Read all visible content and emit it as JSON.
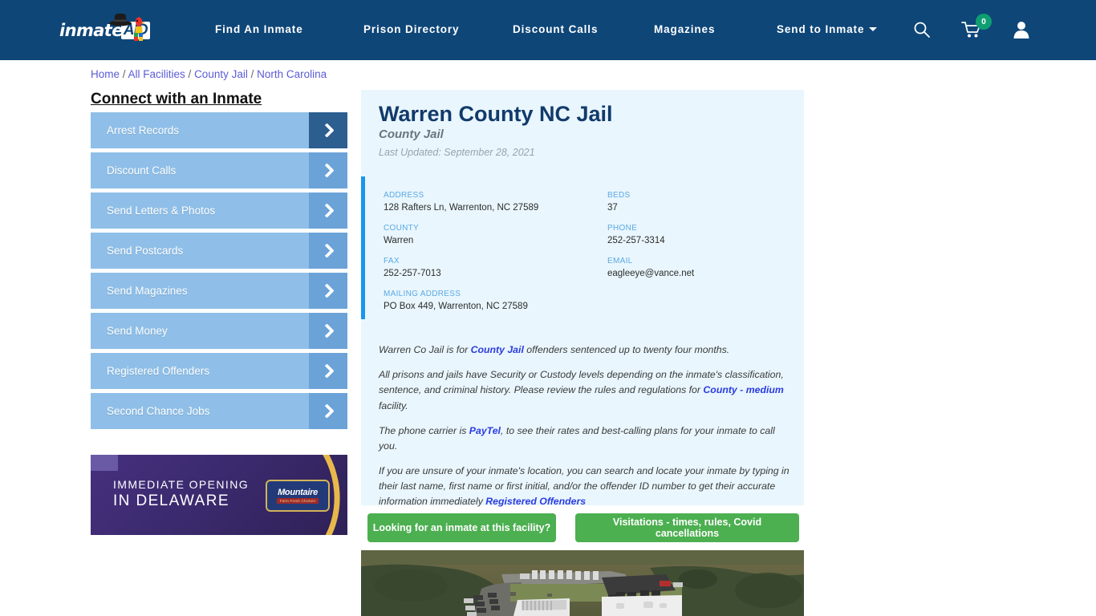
{
  "nav": {
    "logo_text": "inmate",
    "logo_badge": "AID",
    "items": [
      {
        "label": "Find An Inmate"
      },
      {
        "label": "Prison Directory"
      },
      {
        "label": "Discount Calls"
      },
      {
        "label": "Magazines"
      },
      {
        "label": "Send to Inmate"
      }
    ],
    "cart_count": "0",
    "search_icon": "search-icon",
    "cart_icon": "cart-icon",
    "user_icon": "user-icon",
    "bg_color": "#0e4678"
  },
  "breadcrumb": {
    "items": [
      "Home",
      "All Facilities",
      "County Jail",
      "North Carolina"
    ],
    "separator": "/"
  },
  "sidebar": {
    "title": "Connect with an Inmate",
    "items": [
      {
        "label": "Arrest Records"
      },
      {
        "label": "Discount Calls"
      },
      {
        "label": "Send Letters & Photos"
      },
      {
        "label": "Send Postcards"
      },
      {
        "label": "Send Magazines"
      },
      {
        "label": "Send Money"
      },
      {
        "label": "Registered Offenders"
      },
      {
        "label": "Second Chance Jobs"
      }
    ]
  },
  "ad": {
    "line1": "IMMEDIATE OPENING",
    "line2": "IN DELAWARE",
    "brand": "Mountaire",
    "brand_sub": "Farm Fresh Chicken",
    "bg_color": "#3b2a6e",
    "accent_color": "#e8b84b"
  },
  "facility": {
    "title": "Warren County NC Jail",
    "type": "County Jail",
    "updated": "Last Updated: September 28, 2021",
    "details": [
      {
        "key": "ADDRESS",
        "value": "128 Rafters Ln, Warrenton, NC 27589"
      },
      {
        "key": "BEDS",
        "value": "37"
      },
      {
        "key": "COUNTY",
        "value": "Warren"
      },
      {
        "key": "PHONE",
        "value": "252-257-3314"
      },
      {
        "key": "FAX",
        "value": "252-257-7013"
      },
      {
        "key": "EMAIL",
        "value": "eagleeye@vance.net"
      },
      {
        "key": "MAILING ADDRESS",
        "value": "PO Box 449, Warrenton, NC 27589"
      }
    ],
    "paragraphs": {
      "p1_a": "Warren Co Jail is for ",
      "p1_link": "County Jail",
      "p1_b": " offenders sentenced up to twenty four months.",
      "p2_a": "All prisons and jails have Security or Custody levels depending on the inmate's classification, sentence, and criminal history. Please review the rules and regulations for ",
      "p2_link": "County - medium",
      "p2_b": " facility.",
      "p3_a": "The phone carrier is ",
      "p3_link": "PayTel",
      "p3_b": ", to see their rates and best-calling plans for your inmate to call you.",
      "p4_a": "If you are unsure of your inmate's location, you can search and locate your inmate by typing in their last name, first name or first initial, and/or the offender ID number to get their accurate information immediately ",
      "p4_link": "Registered Offenders"
    },
    "panel_bg": "#e9f6fd",
    "accent_color": "#1a96ec"
  },
  "buttons": {
    "looking": "Looking for an inmate at this facility?",
    "visitations": "Visitations - times, rules, Covid cancellations",
    "color": "#4caf50"
  },
  "aerial": {
    "alt": "aerial satellite view of jail facility"
  }
}
